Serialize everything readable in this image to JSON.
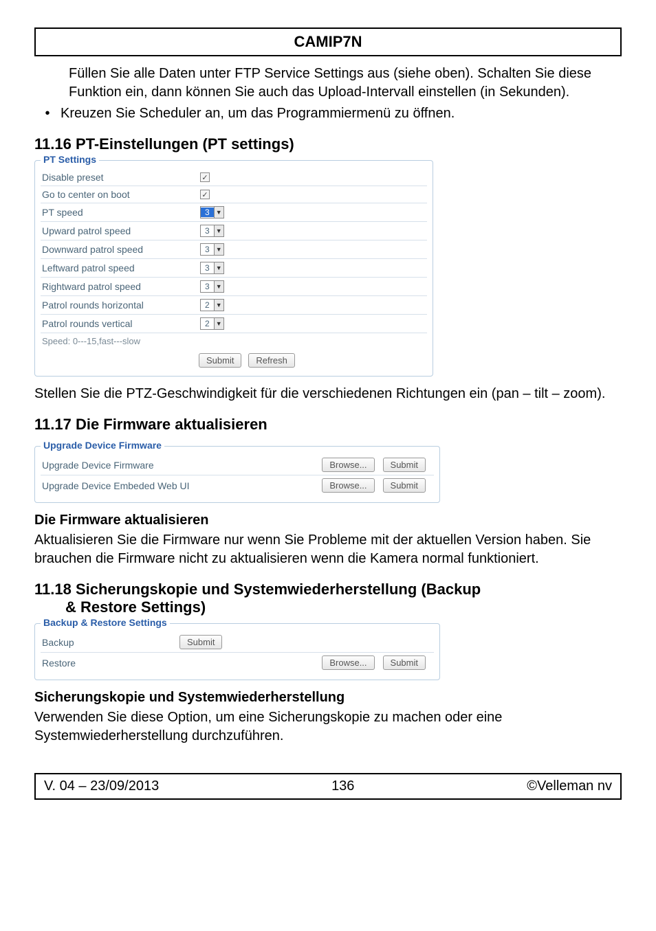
{
  "header": {
    "title": "CAMIP7N"
  },
  "intro": {
    "para": "Füllen Sie alle Daten unter FTP Service Settings aus (siehe oben). Schalten Sie diese Funktion ein, dann können Sie auch das Upload-Intervall einstellen (in Sekunden).",
    "bullet": "Kreuzen Sie Scheduler an, um das Programmiermenü zu öffnen."
  },
  "sec1116": {
    "heading": "11.16 PT-Einstellungen (PT settings)",
    "legend": "PT Settings",
    "rows": {
      "disable_preset": {
        "label": "Disable preset"
      },
      "go_center": {
        "label": "Go to center on boot"
      },
      "pt_speed": {
        "label": "PT speed",
        "value": "3"
      },
      "up_speed": {
        "label": "Upward patrol speed",
        "value": "3"
      },
      "down_speed": {
        "label": "Downward patrol speed",
        "value": "3"
      },
      "left_speed": {
        "label": "Leftward patrol speed",
        "value": "3"
      },
      "right_speed": {
        "label": "Rightward patrol speed",
        "value": "3"
      },
      "rounds_h": {
        "label": "Patrol rounds horizontal",
        "value": "2"
      },
      "rounds_v": {
        "label": "Patrol rounds vertical",
        "value": "2"
      }
    },
    "speed_note": "Speed: 0---15,fast---slow",
    "buttons": {
      "submit": "Submit",
      "refresh": "Refresh"
    },
    "after_para": "Stellen Sie die PTZ-Geschwindigkeit für die verschiedenen Richtungen ein (pan – tilt – zoom)."
  },
  "sec1117": {
    "heading": "11.17 Die Firmware aktualisieren",
    "legend": "Upgrade Device Firmware",
    "rows": {
      "fw": {
        "label": "Upgrade Device Firmware"
      },
      "webui": {
        "label": "Upgrade Device Embeded Web UI"
      }
    },
    "buttons": {
      "browse": "Browse...",
      "submit": "Submit"
    },
    "sub_heading": "Die Firmware aktualisieren",
    "sub_para": "Aktualisieren Sie die Firmware nur wenn Sie Probleme mit der aktuellen Version haben. Sie brauchen die Firmware nicht zu aktualisieren wenn die Kamera normal funktioniert."
  },
  "sec1118": {
    "heading": "11.18 Sicherungskopie und Systemwiederherstellung (Backup & Restore Settings)",
    "legend": "Backup & Restore Settings",
    "rows": {
      "backup": {
        "label": "Backup"
      },
      "restore": {
        "label": "Restore"
      }
    },
    "buttons": {
      "browse": "Browse...",
      "submit": "Submit"
    },
    "sub_heading": "Sicherungskopie und Systemwiederherstellung",
    "sub_para": "Verwenden Sie diese Option, um eine Sicherungskopie zu machen oder eine Systemwiederherstellung durchzuführen."
  },
  "footer": {
    "left": "V. 04 – 23/09/2013",
    "center": "136",
    "right": "©Velleman nv"
  }
}
